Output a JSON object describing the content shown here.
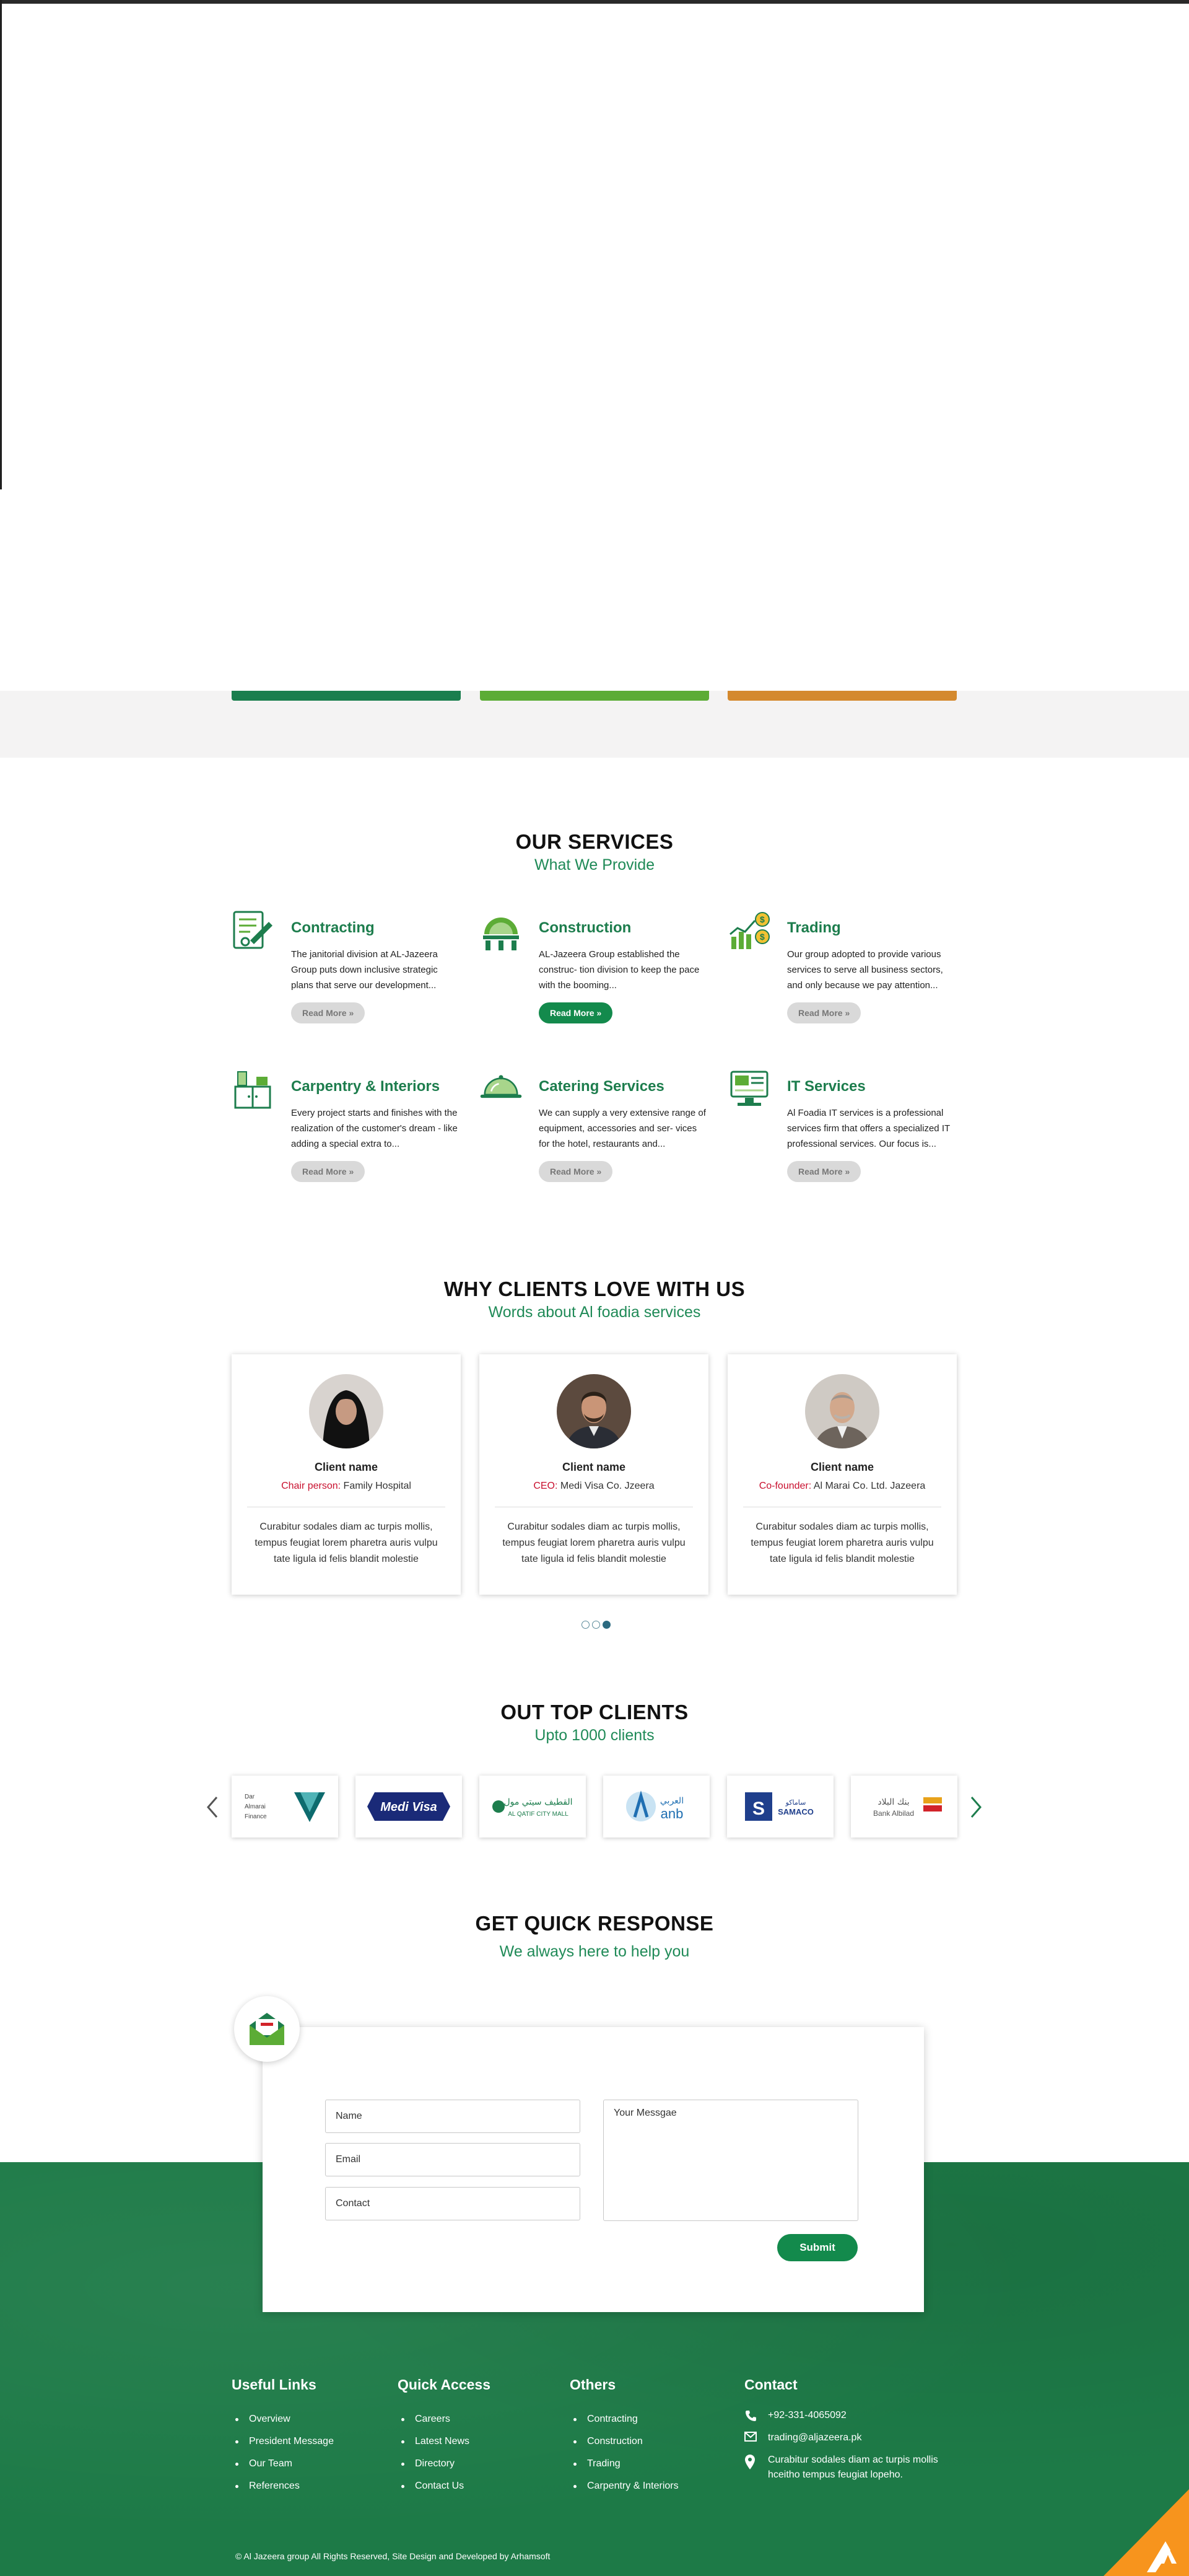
{
  "services_section": {
    "title": "OUR SERVICES",
    "subtitle": "What We Provide",
    "items": [
      {
        "title": "Contracting",
        "text": "The janitorial division at AL-Jazeera Group puts down inclusive strategic plans that serve our development...",
        "button": "Read More »",
        "icon": "contracting-icon"
      },
      {
        "title": "Construction",
        "text": "AL-Jazeera Group established the construc- tion division to keep the pace with the booming...",
        "button": "Read More »",
        "icon": "construction-icon"
      },
      {
        "title": "Trading",
        "text": "Our group adopted to provide various services to serve all business sectors, and only because we pay attention...",
        "button": "Read More »",
        "icon": "trading-icon"
      },
      {
        "title": "Carpentry & Interiors",
        "text": "Every project starts and finishes with the realization of the customer's dream - like adding a special extra to...",
        "button": "Read More »",
        "icon": "carpentry-icon"
      },
      {
        "title": "Catering Services",
        "text": "We can supply a very extensive range of equipment, accessories and ser- vices for the hotel, restaurants and...",
        "button": "Read More »",
        "icon": "catering-icon"
      },
      {
        "title": "IT Services",
        "text": "Al Foadia IT services is a professional services firm that offers a specialized IT professional services. Our focus is...",
        "button": "Read More »",
        "icon": "it-services-icon"
      }
    ]
  },
  "testimonials_section": {
    "title": "WHY CLIENTS LOVE WITH US",
    "subtitle": "Words about Al foadia services",
    "cards": [
      {
        "name": "Client name",
        "role": "Chair person:",
        "company": " Family Hospital",
        "quote": "Curabitur sodales diam ac turpis mollis, tempus feugiat lorem pharetra auris vulpu tate ligula id felis blandit molestie"
      },
      {
        "name": "Client name",
        "role": "CEO:",
        "company": " Medi Visa Co. Jzeera",
        "quote": "Curabitur sodales diam ac turpis mollis, tempus feugiat lorem pharetra auris vulpu tate ligula id felis blandit molestie"
      },
      {
        "name": "Client name",
        "role": "Co-founder:",
        "company": " Al Marai Co. Ltd. Jazeera",
        "quote": "Curabitur sodales diam ac turpis mollis, tempus feugiat lorem pharetra auris vulpu tate ligula id felis blandit molestie"
      }
    ],
    "active_dot": 3
  },
  "clients_section": {
    "title": "OUT TOP CLIENTS",
    "subtitle": "Upto 1000 clients",
    "logos": [
      {
        "name": "Dar Al Marai Co.",
        "line1": "Dar",
        "line2": "Almarai",
        "line3": "Finance"
      },
      {
        "name": "Medi Visa",
        "text": "Medi Visa"
      },
      {
        "name": "Al Qatif City Mall",
        "arabic": "القطيف سيتي مول",
        "text": "AL QATIF CITY MALL"
      },
      {
        "name": "anb",
        "arabic": "العربي",
        "text": "anb"
      },
      {
        "name": "SAMACO",
        "arabic": "ساماكو",
        "text": "SAMACO"
      },
      {
        "name": "Bank Albilad",
        "arabic": "بنك البلاد",
        "text": "Bank Albilad"
      }
    ]
  },
  "contact_section": {
    "title": "GET QUICK RESPONSE",
    "subtitle": "We always here to help you",
    "name_placeholder": "Name",
    "email_placeholder": "Email",
    "contact_placeholder": "Contact",
    "message_placeholder": "Your Messgae",
    "submit_label": "Submit"
  },
  "footer": {
    "useful_links": {
      "title": "Useful Links",
      "items": [
        "Overview",
        "President Message",
        "Our Team",
        "References"
      ]
    },
    "quick_access": {
      "title": "Quick Access",
      "items": [
        "Careers",
        "Latest News",
        "Directory",
        "Contact Us"
      ]
    },
    "others": {
      "title": "Others",
      "items": [
        "Contracting",
        "Construction",
        "Trading",
        "Carpentry & Interiors"
      ]
    },
    "contact": {
      "title": "Contact",
      "phone": "+92-331-4065092",
      "email": "trading@aljazeera.pk",
      "address": "Curabitur sodales diam ac turpis mollis hceitho tempus feugiat lopeho."
    },
    "copyright": "© Al Jazeera group All Rights Reserved, Site Design and Developed by Arhamsoft"
  },
  "colors": {
    "brand_green": "#138a4c",
    "heading_green": "#1d7d4d",
    "footer_green": "#1d7a47",
    "accent_orange": "#f7941d",
    "role_red": "#c8102e"
  }
}
